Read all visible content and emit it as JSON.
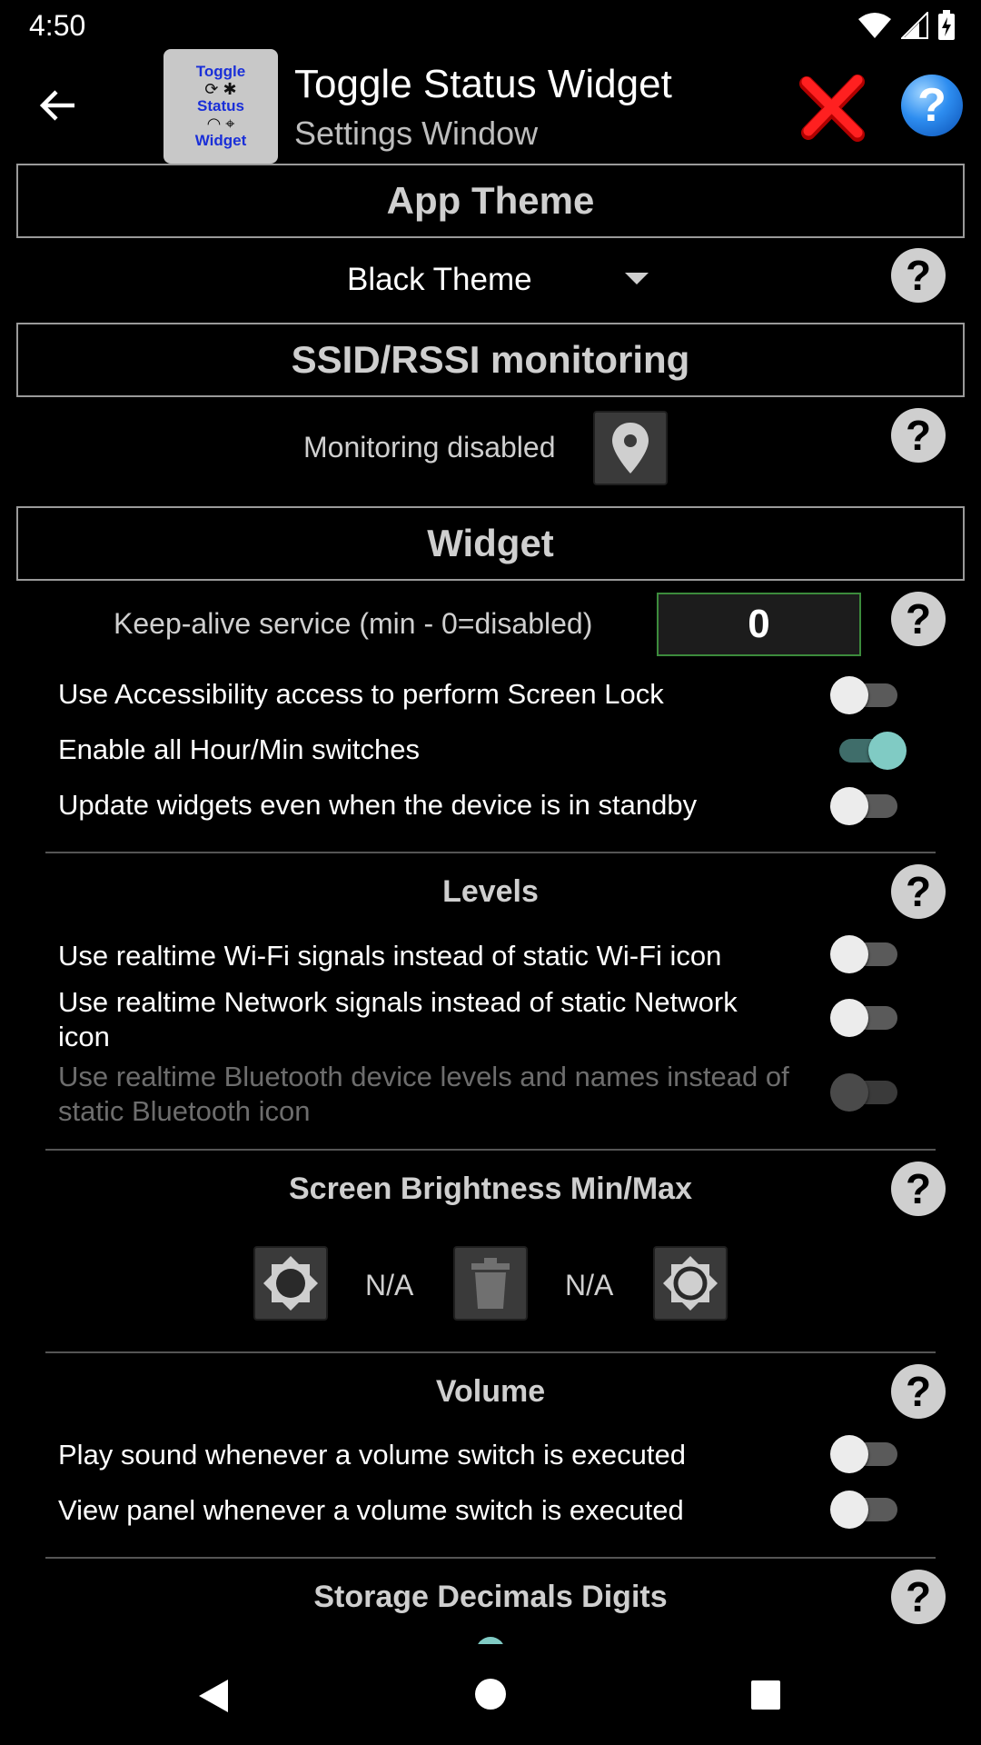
{
  "status_bar": {
    "time": "4:50"
  },
  "header": {
    "app_icon_lines": [
      "Toggle",
      "Status",
      "Widget"
    ],
    "title": "Toggle Status Widget",
    "subtitle": "Settings Window"
  },
  "app_theme": {
    "section_title": "App Theme",
    "selected": "Black Theme"
  },
  "ssid": {
    "section_title": "SSID/RSSI monitoring",
    "status": "Monitoring disabled"
  },
  "widget": {
    "section_title": "Widget",
    "keepalive_label": "Keep-alive service (min - 0=disabled)",
    "keepalive_value": "0",
    "options": [
      {
        "label": "Use Accessibility access to perform Screen Lock",
        "on": false
      },
      {
        "label": "Enable all Hour/Min switches",
        "on": true
      },
      {
        "label": "Update widgets even when the device is in standby",
        "on": false
      }
    ]
  },
  "levels": {
    "title": "Levels",
    "options": [
      {
        "label": "Use realtime Wi-Fi signals instead of static Wi-Fi icon",
        "on": false
      },
      {
        "label": "Use realtime Network signals instead of static Network icon",
        "on": false
      },
      {
        "label": "Use realtime Bluetooth device levels and names instead of static Bluetooth icon",
        "on": false,
        "disabled": true
      }
    ]
  },
  "brightness": {
    "title": "Screen Brightness Min/Max",
    "min_value": "N/A",
    "max_value": "N/A"
  },
  "volume": {
    "title": "Volume",
    "options": [
      {
        "label": "Play sound whenever a volume switch is executed",
        "on": false
      },
      {
        "label": "View panel whenever a volume switch is executed",
        "on": false
      }
    ]
  },
  "storage": {
    "title": "Storage Decimals Digits"
  },
  "help_glyph": "?",
  "colors": {
    "accent": "#80cbc4",
    "accent_track": "#3f6d6a",
    "section_border": "#9a9a9a",
    "keepalive_border": "#3c8b3c"
  }
}
